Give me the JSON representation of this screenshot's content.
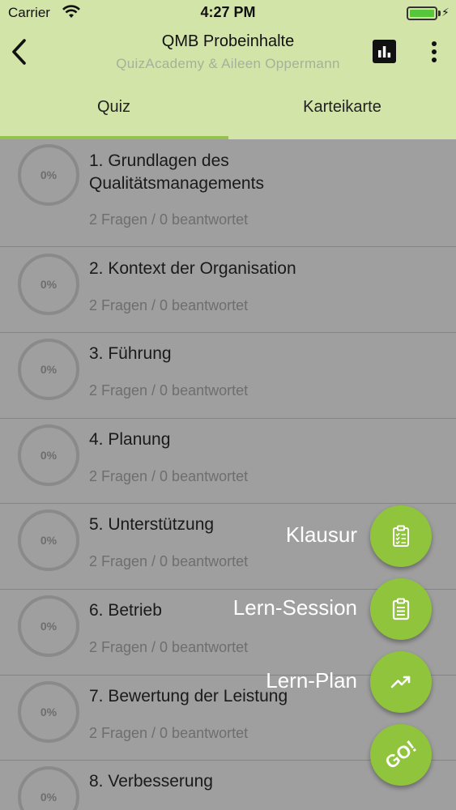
{
  "statusbar": {
    "carrier": "Carrier",
    "time": "4:27 PM"
  },
  "navbar": {
    "title": "QMB Probeinhalte",
    "subtitle": "QuizAcademy & Aileen Oppermann"
  },
  "tabs": [
    {
      "label": "Quiz",
      "active": true
    },
    {
      "label": "Karteikarte",
      "active": false
    }
  ],
  "chapters": [
    {
      "progress": "0%",
      "title": "1. Grundlagen des Qualitätsmanagements",
      "stats": "2 Fragen / 0 beantwortet"
    },
    {
      "progress": "0%",
      "title": "2. Kontext der Organisation",
      "stats": "2 Fragen / 0 beantwortet"
    },
    {
      "progress": "0%",
      "title": "3. Führung",
      "stats": "2 Fragen / 0 beantwortet"
    },
    {
      "progress": "0%",
      "title": "4. Planung",
      "stats": "2 Fragen / 0 beantwortet"
    },
    {
      "progress": "0%",
      "title": "5. Unterstützung",
      "stats": "2 Fragen / 0 beantwortet"
    },
    {
      "progress": "0%",
      "title": "6. Betrieb",
      "stats": "2 Fragen / 0 beantwortet"
    },
    {
      "progress": "0%",
      "title": "7. Bewertung der Leistung",
      "stats": "2 Fragen / 0 beantwortet"
    },
    {
      "progress": "0%",
      "title": "8. Verbesserung",
      "stats": ""
    }
  ],
  "fab_menu": {
    "klausur": "Klausur",
    "lern_session": "Lern-Session",
    "lern_plan": "Lern-Plan",
    "go": "GO!"
  },
  "colors": {
    "header": "#d2e4a8",
    "accent": "#8fc43c",
    "overlay": "#9f9f9f"
  }
}
